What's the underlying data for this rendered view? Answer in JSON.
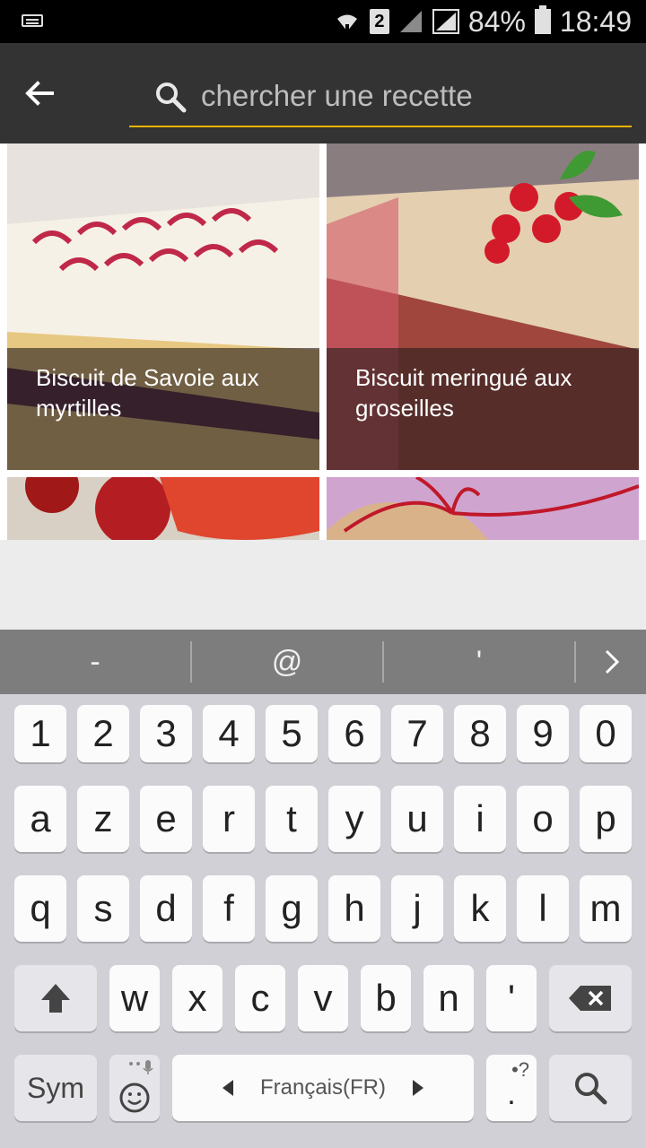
{
  "status": {
    "battery": "84%",
    "time": "18:49",
    "sim": "2"
  },
  "search": {
    "placeholder": "chercher une recette",
    "value": ""
  },
  "recipes": [
    {
      "title": "Biscuit de Savoie aux myrtilles"
    },
    {
      "title": "Biscuit meringué aux groseilles"
    }
  ],
  "suggestions": [
    "-",
    "@",
    "'"
  ],
  "keyboard": {
    "row_numbers": [
      "1",
      "2",
      "3",
      "4",
      "5",
      "6",
      "7",
      "8",
      "9",
      "0"
    ],
    "row1": [
      "a",
      "z",
      "e",
      "r",
      "t",
      "y",
      "u",
      "i",
      "o",
      "p"
    ],
    "row2": [
      "q",
      "s",
      "d",
      "f",
      "g",
      "h",
      "j",
      "k",
      "l",
      "m"
    ],
    "row3": [
      "w",
      "x",
      "c",
      "v",
      "b",
      "n",
      "'"
    ],
    "sym": "Sym",
    "language": "Français(FR)",
    "punct_hint": "•?",
    "punct_main": "."
  },
  "colors": {
    "appbar": "#333333",
    "accent_underline": "#f0b400"
  },
  "icons": [
    "back-arrow-icon",
    "search-icon",
    "shift-icon",
    "backspace-icon",
    "emoji-icon",
    "microphone-icon",
    "keyboard-icon",
    "wifi-icon",
    "signal-icon",
    "battery-icon"
  ]
}
